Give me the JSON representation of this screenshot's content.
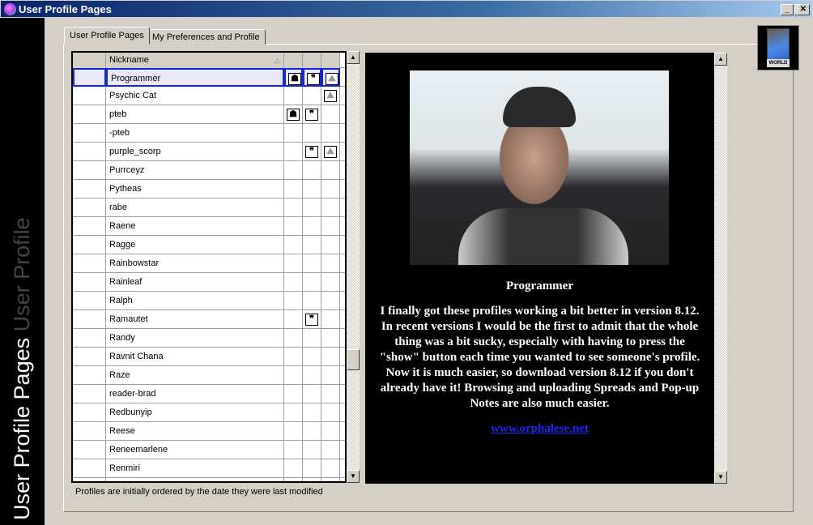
{
  "window": {
    "title": "User Profile Pages",
    "minimize": "_",
    "maximize": "□",
    "close": "✕"
  },
  "sidebar": {
    "banner": "User Profile Pages",
    "banner_faded": "User Profile"
  },
  "tabs": [
    {
      "label": "User Profile Pages",
      "active": true
    },
    {
      "label": "My Preferences and Profile",
      "active": false
    }
  ],
  "table": {
    "header": {
      "nickname": "Nickname",
      "sort_icon": "sort-ascending-icon"
    },
    "rows": [
      {
        "nickname": "Programmer",
        "avatar": true,
        "quote": true,
        "picture": true,
        "selected": true
      },
      {
        "nickname": "Psychic Cat",
        "avatar": false,
        "quote": false,
        "picture": true
      },
      {
        "nickname": "pteb",
        "avatar": true,
        "quote": true,
        "picture": false
      },
      {
        "nickname": "-pteb",
        "avatar": false,
        "quote": false,
        "picture": false
      },
      {
        "nickname": "purple_scorp",
        "avatar": false,
        "quote": true,
        "picture": true
      },
      {
        "nickname": "Purrceyz"
      },
      {
        "nickname": "Pytheas"
      },
      {
        "nickname": "rabe"
      },
      {
        "nickname": "Raene"
      },
      {
        "nickname": "Ragge"
      },
      {
        "nickname": "Rainbowstar"
      },
      {
        "nickname": "Rainleaf"
      },
      {
        "nickname": "Ralph"
      },
      {
        "nickname": "Ramautet",
        "quote": true
      },
      {
        "nickname": "Randy"
      },
      {
        "nickname": "Ravnit Chana"
      },
      {
        "nickname": "Raze"
      },
      {
        "nickname": "reader-brad"
      },
      {
        "nickname": "Redbunyip"
      },
      {
        "nickname": "Reese"
      },
      {
        "nickname": "Reneemarlene"
      },
      {
        "nickname": "Renmiri"
      },
      {
        "nickname": "",
        "avatar": true
      }
    ]
  },
  "profile": {
    "name": "Programmer",
    "bio": "I finally got these profiles working a bit better in version 8.12. In recent versions I would be the first to admit that the whole thing was a bit sucky, especially with having to press the \"show\" button each time you wanted to see someone's profile. Now it is much easier, so download version 8.12 if you don't already have it! Browsing and uploading Spreads and Pop-up Notes are also much easier.",
    "link": "www.orphalese.net"
  },
  "card": {
    "label": "WORLD"
  },
  "footer": "Profiles are initially ordered by the date they were last modified",
  "colors": {
    "title_bar": "#0a246a",
    "selection_border": "#1428d4",
    "link": "#2222ff"
  }
}
